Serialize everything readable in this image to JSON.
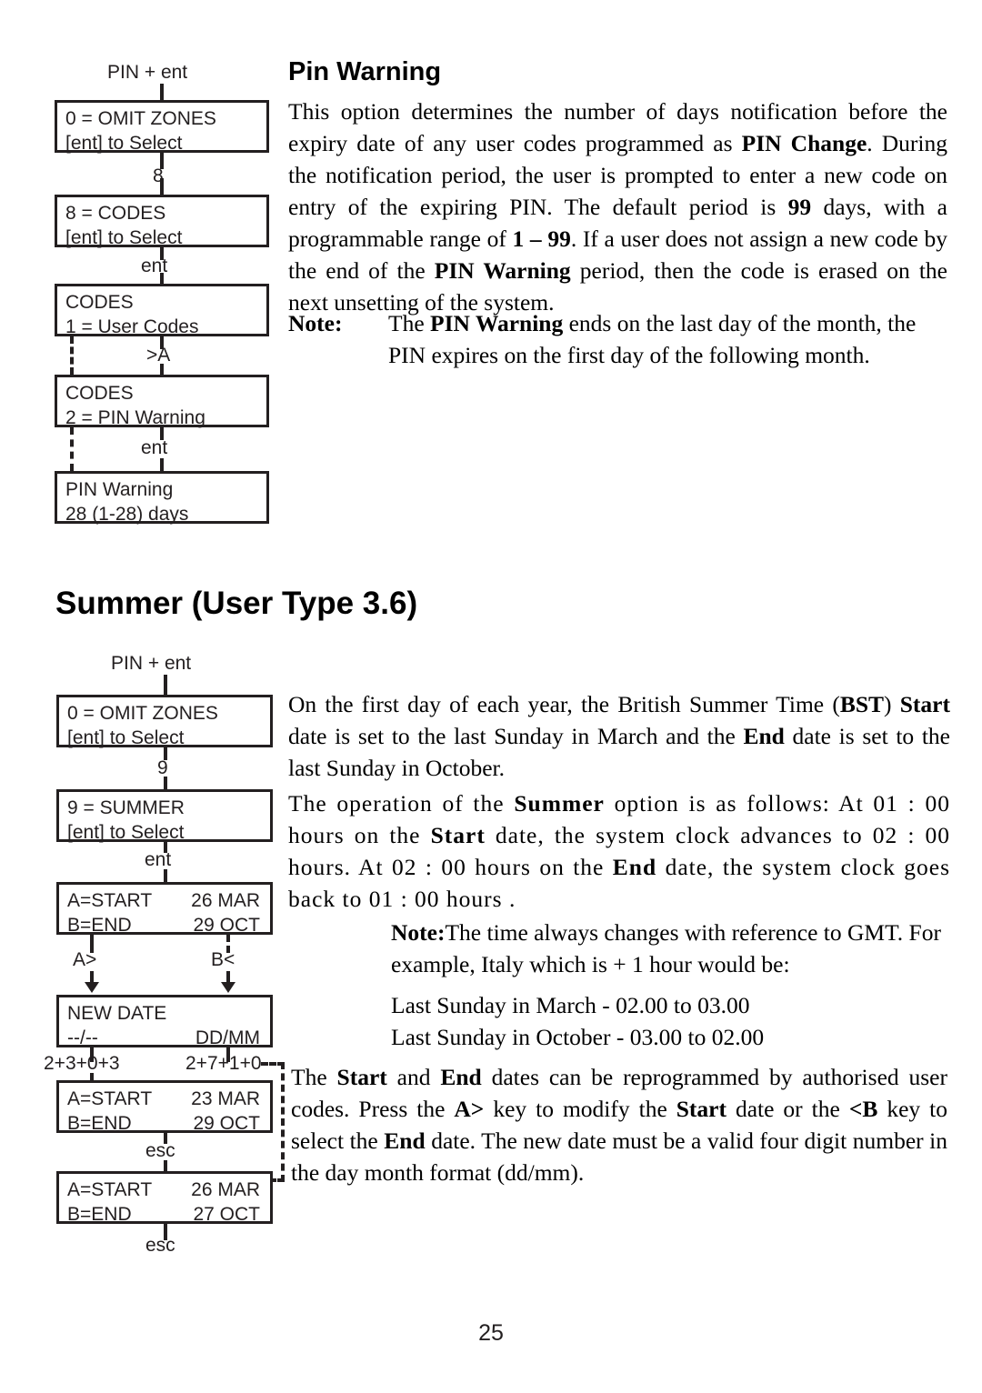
{
  "page": {
    "number": "25"
  },
  "section1": {
    "heading": "Pin Warning",
    "paragraph1_parts": [
      {
        "t": "This option determines the number of days notification before the expiry date of any user codes programmed as ",
        "b": false
      },
      {
        "t": "PIN Change",
        "b": true
      },
      {
        "t": ".  During the notification period, the user is prompted to enter a new code on entry of the expiring PIN. The default period is ",
        "b": false
      },
      {
        "t": "99",
        "b": true
      },
      {
        "t": " days, with a programmable range of ",
        "b": false
      },
      {
        "t": "1 – 99",
        "b": true
      },
      {
        "t": ". If a user does not assign a new code by the end of the ",
        "b": false
      },
      {
        "t": "PIN Warning",
        "b": true
      },
      {
        "t": " period, then the code is erased on the next unsetting of the system.",
        "b": false
      }
    ],
    "note_label": "Note:",
    "note_parts": [
      {
        "t": "The ",
        "b": false
      },
      {
        "t": "PIN Warning",
        "b": true
      },
      {
        "t": " ends on the last day of the month, the PIN expires on the first day of the following month.",
        "b": false
      }
    ],
    "flow": {
      "entry_label": "PIN + ent",
      "boxes": [
        {
          "line1": "0 = OMIT ZONES",
          "line2": "[ent] to Select"
        },
        {
          "line1": "8 = CODES",
          "line2": "[ent] to Select"
        },
        {
          "line1": "CODES",
          "line2": "1 = User Codes"
        },
        {
          "line1": "CODES",
          "line2": "2 = PIN Warning"
        },
        {
          "line1": "PIN Warning",
          "line2": "28 (1-28) days"
        }
      ],
      "connectors": [
        "8",
        "ent",
        ">A",
        "ent"
      ]
    }
  },
  "section2": {
    "heading": "Summer (User Type 3.6)",
    "paragraph1_parts": [
      {
        "t": "On the first day of each year, the British Summer Time (",
        "b": false
      },
      {
        "t": "BST",
        "b": true
      },
      {
        "t": ") ",
        "b": false
      },
      {
        "t": "Start",
        "b": true
      },
      {
        "t": " date is set to the last Sunday in March and the ",
        "b": false
      },
      {
        "t": "End",
        "b": true
      },
      {
        "t": " date is set to the last Sunday in October.",
        "b": false
      }
    ],
    "paragraph2_parts": [
      {
        "t": "The operation of the ",
        "b": false
      },
      {
        "t": "Summer",
        "b": true
      },
      {
        "t": " option is as follows: At 01 :  00 hours on the ",
        "b": false
      },
      {
        "t": "Start",
        "b": true
      },
      {
        "t": " date, the system clock advances to 02 : 00 hours. At 02 : 00 hours on the ",
        "b": false
      },
      {
        "t": "End",
        "b": true
      },
      {
        "t": " date, the system clock goes back to 01 : 00 hours .",
        "b": false
      }
    ],
    "note_label": "Note:",
    "note_text": "The time always changes with reference to GMT. For example, Italy which is + 1 hour would be:",
    "example_line1": "Last Sunday in March - 02.00 to 03.00",
    "example_line2": "Last Sunday in October - 03.00 to 02.00",
    "paragraph3_parts": [
      {
        "t": "The ",
        "b": false
      },
      {
        "t": "Start",
        "b": true
      },
      {
        "t": " and ",
        "b": false
      },
      {
        "t": "End",
        "b": true
      },
      {
        "t": " dates can be reprogrammed by authorised user codes. Press the ",
        "b": false
      },
      {
        "t": "A>",
        "b": true
      },
      {
        "t": " key to modify the ",
        "b": false
      },
      {
        "t": "Start",
        "b": true
      },
      {
        "t": " date or the ",
        "b": false
      },
      {
        "t": "<B",
        "b": true
      },
      {
        "t": " key to select the ",
        "b": false
      },
      {
        "t": "End",
        "b": true
      },
      {
        "t": " date. The new date must be a valid four digit number in the day month format (dd/mm).",
        "b": false
      }
    ],
    "flow": {
      "entry_label": "PIN + ent",
      "boxes": [
        {
          "line1": "0 = OMIT ZONES",
          "line2": "[ent] to Select"
        },
        {
          "line1": "9 = SUMMER",
          "line2": "[ent] to Select"
        },
        {
          "line1_left": "A=START",
          "line1_right": "26 MAR",
          "line2_left": "B=END",
          "line2_right": "29 OCT"
        },
        {
          "line1_left": "NEW DATE",
          "line1_right": "",
          "line2_left": "--/--",
          "line2_right": "DD/MM"
        },
        {
          "line1_left": "A=START",
          "line1_right": "23 MAR",
          "line2_left": "B=END",
          "line2_right": "29 OCT"
        },
        {
          "line1_left": "A=START",
          "line1_right": "26 MAR",
          "line2_left": "B=END",
          "line2_right": "27 OCT"
        }
      ],
      "connectors": {
        "c1": "9",
        "c2": "ent",
        "c3_left": "A>",
        "c3_right": "B<",
        "c4_left": "2+3+0+3",
        "c4_right": "2+7+1+0",
        "c5": "esc",
        "c6": "esc"
      }
    }
  },
  "colors": {
    "ink": "#231f20",
    "text": "#000000"
  }
}
